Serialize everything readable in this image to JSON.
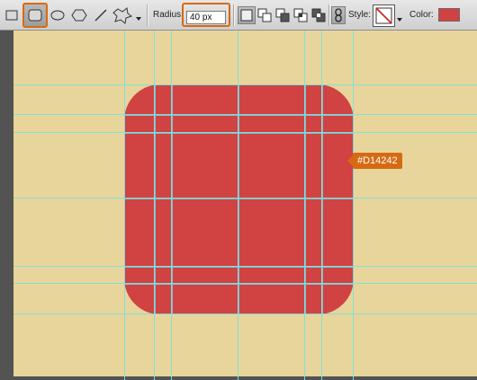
{
  "toolbar": {
    "tools": [
      {
        "name": "rectangle-tool-icon",
        "active": false
      },
      {
        "name": "rounded-rectangle-tool-icon",
        "active": true
      },
      {
        "name": "ellipse-tool-icon",
        "active": false
      },
      {
        "name": "polygon-tool-icon",
        "active": false
      },
      {
        "name": "line-tool-icon",
        "active": false
      },
      {
        "name": "custom-shape-tool-icon",
        "active": false
      }
    ],
    "radius_label": "Radius:",
    "radius_value": "40 px",
    "style_label": "Style:",
    "color_label": "Color:",
    "color_value": "#D14242"
  },
  "canvas": {
    "background_color": "#E8D59B",
    "shape_color": "#D14242",
    "color_tooltip": "#D14242"
  },
  "colors": {
    "accent": "#D66A13",
    "guide": "#79E3DC"
  }
}
